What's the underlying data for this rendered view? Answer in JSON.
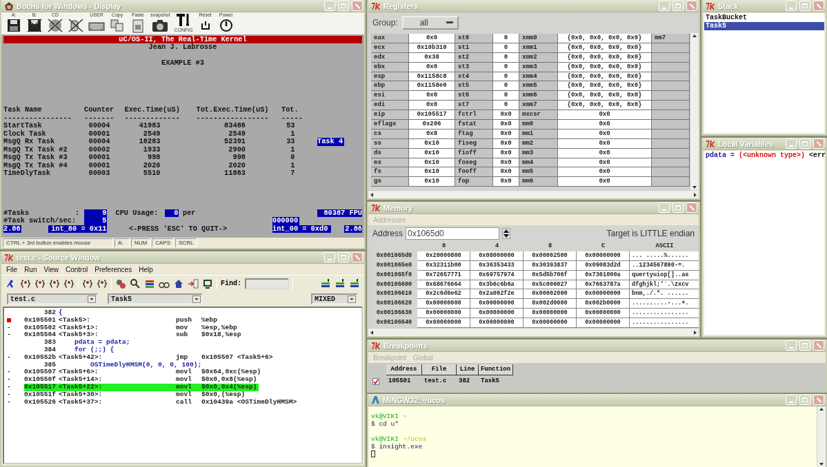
{
  "bochs": {
    "title": "Bochs for Windows - Display",
    "toolbar": [
      {
        "kind": "floppy",
        "label": "A:"
      },
      {
        "kind": "floppy-off",
        "label": "B:"
      },
      {
        "kind": "cdrom",
        "label": "CD"
      },
      {
        "kind": "mouse"
      },
      {
        "kind": "keyboard",
        "label": "USER"
      },
      {
        "kind": "copy",
        "label": "Copy"
      },
      {
        "kind": "paste",
        "label": "Paste"
      },
      {
        "kind": "camera",
        "label": "snapshot"
      },
      {
        "kind": "config",
        "label": "CONFIG"
      },
      {
        "kind": "reset",
        "label": "Reset"
      },
      {
        "kind": "power",
        "label": "Power"
      }
    ],
    "screen": {
      "banner": "uC/OS-II, The Real-Time Kernel",
      "author": "Jean J. Labrosse",
      "heading": "EXAMPLE #3",
      "columns": [
        {
          "label": "Task Name",
          "rule": "----------------"
        },
        {
          "label": "Counter",
          "rule": "-------"
        },
        {
          "label": "Exec.Time(uS)",
          "rule": "-------------"
        },
        {
          "label": "Tot.Exec.Time(uS)",
          "rule": "-----------------"
        },
        {
          "label": "Tot.",
          "rule": "-----"
        }
      ],
      "rows": [
        {
          "cells": [
            "StartTask",
            "00004",
            "41983",
            "83486",
            "53"
          ]
        },
        {
          "cells": [
            "Clock Task",
            "00001",
            "2549",
            "2549",
            "1"
          ]
        },
        {
          "cells": [
            "MsgQ Rx Task",
            "00004",
            "18283",
            "52391",
            "33"
          ],
          "badge": "Task 4"
        },
        {
          "cells": [
            "MsgQ Tx Task #2",
            "00002",
            "1933",
            "2900",
            "1"
          ]
        },
        {
          "cells": [
            "MsgQ Tx Task #3",
            "00001",
            "998",
            "998",
            "0"
          ]
        },
        {
          "cells": [
            "MsgQ Tx Task #4",
            "00001",
            "2020",
            "2020",
            "1"
          ]
        },
        {
          "cells": [
            "TimeDlyTask",
            "00003",
            "5510",
            "11863",
            "7"
          ]
        }
      ],
      "tasks_label": "#Tasks",
      "tasks_colon": ":",
      "tasks_value": "9",
      "cpu_label": "CPU Usage:",
      "cpu_value": "0",
      "cpu_unit": "per",
      "fpu": "80387 FPU",
      "switch_label": "#Task switch/sec:",
      "switch_value": "5",
      "hex_value": "000000",
      "left_version": "2.86",
      "int80": "int_80 = 0x11",
      "quit_hint": "<-PRESS 'ESC' TO QUIT->",
      "int00": "int_00 = 0xd0",
      "right_version": "2.86"
    },
    "status_bar": [
      "CTRL + 3rd button enables mouse",
      "A:",
      "NUM",
      "CAPS",
      "SCRL"
    ]
  },
  "source": {
    "title": "test.c - Source Window",
    "menu": [
      "File",
      "Run",
      "View",
      "Control",
      "Preferences",
      "Help"
    ],
    "find_label": "Find:",
    "file": "test.c",
    "function": "Task5",
    "mode": "MIXED",
    "lines": [
      {
        "kind": "src",
        "number": "382",
        "text": "{"
      },
      {
        "kind": "asm",
        "breakpoint": true,
        "current": false,
        "address": "0x105501",
        "symbol": "<Task5>:",
        "op": "push",
        "args": "%ebp"
      },
      {
        "kind": "asm",
        "marker": "-",
        "breakpoint": false,
        "current": false,
        "address": "0x105502",
        "symbol": "<Task5+1>:",
        "op": "mov",
        "args": "%esp,%ebp"
      },
      {
        "kind": "asm",
        "marker": "-",
        "breakpoint": false,
        "current": false,
        "address": "0x105504",
        "symbol": "<Task5+3>:",
        "op": "sub",
        "args": "$0x18,%esp"
      },
      {
        "kind": "src",
        "number": "383",
        "text": "    pdata = pdata;"
      },
      {
        "kind": "src",
        "number": "384",
        "text": "    for (;;) {"
      },
      {
        "kind": "asm",
        "marker": "-",
        "breakpoint": false,
        "current": false,
        "address": "0x10552b",
        "symbol": "<Task5+42>:",
        "op": "jmp",
        "args": "0x105507 <Task5+6>"
      },
      {
        "kind": "src",
        "number": "385",
        "text": "        OSTimeDlyHMSM(0, 0, 0, 100);"
      },
      {
        "kind": "asm",
        "marker": "-",
        "breakpoint": false,
        "current": false,
        "address": "0x105507",
        "symbol": "<Task5+6>:",
        "op": "movl",
        "args": "$0x64,0xc(%esp)"
      },
      {
        "kind": "asm",
        "marker": "-",
        "breakpoint": false,
        "current": false,
        "address": "0x10550f",
        "symbol": "<Task5+14>:",
        "op": "movl",
        "args": "$0x0,0x8(%esp)"
      },
      {
        "kind": "asm",
        "marker": "-",
        "breakpoint": false,
        "current": true,
        "address": "0x105517",
        "symbol": "<Task5+22>:",
        "op": "movl",
        "args": "$0x0,0x4(%esp)"
      },
      {
        "kind": "asm",
        "marker": "-",
        "breakpoint": false,
        "current": false,
        "address": "0x10551f",
        "symbol": "<Task5+30>:",
        "op": "movl",
        "args": "$0x0,(%esp)"
      },
      {
        "kind": "asm",
        "marker": "-",
        "breakpoint": false,
        "current": false,
        "address": "0x105526",
        "symbol": "<Task5+37>:",
        "op": "call",
        "args": "0x10439a <OSTimeDlyHMSM>"
      }
    ]
  },
  "registers": {
    "title": "Registers",
    "group_label": "Group:",
    "group": "all",
    "trailing_label": "mm7",
    "rows": [
      [
        "eax",
        "0x0",
        "st0",
        "0",
        "xmm0",
        "{0x0, 0x0, 0x0, 0x0}"
      ],
      [
        "ecx",
        "0x10b310",
        "st1",
        "0",
        "xmm1",
        "{0x0, 0x0, 0x0, 0x0}"
      ],
      [
        "edx",
        "0x38",
        "st2",
        "0",
        "xmm2",
        "{0x0, 0x0, 0x0, 0x0}"
      ],
      [
        "ebx",
        "0x0",
        "st3",
        "0",
        "xmm3",
        "{0x0, 0x0, 0x0, 0x0}"
      ],
      [
        "esp",
        "0x1158c8",
        "st4",
        "0",
        "xmm4",
        "{0x0, 0x0, 0x0, 0x0}"
      ],
      [
        "ebp",
        "0x1158e0",
        "st5",
        "0",
        "xmm5",
        "{0x0, 0x0, 0x0, 0x0}"
      ],
      [
        "esi",
        "0x0",
        "st6",
        "0",
        "xmm6",
        "{0x0, 0x0, 0x0, 0x0}"
      ],
      [
        "edi",
        "0x0",
        "st7",
        "0",
        "xmm7",
        "{0x0, 0x0, 0x0, 0x0}"
      ],
      [
        "eip",
        "0x105517",
        "fctrl",
        "0x0",
        "mxcsr",
        "0x0"
      ],
      [
        "eflags",
        "0x206",
        "fstat",
        "0x0",
        "mm0",
        "0x0"
      ],
      [
        "cs",
        "0x8",
        "ftag",
        "0x0",
        "mm1",
        "0x0"
      ],
      [
        "ss",
        "0x10",
        "fiseg",
        "0x0",
        "mm2",
        "0x0"
      ],
      [
        "ds",
        "0x10",
        "fioff",
        "0x0",
        "mm3",
        "0x0"
      ],
      [
        "es",
        "0x10",
        "foseg",
        "0x0",
        "mm4",
        "0x0"
      ],
      [
        "fs",
        "0x10",
        "fooff",
        "0x0",
        "mm5",
        "0x0"
      ],
      [
        "gs",
        "0x10",
        "fop",
        "0x0",
        "mm6",
        "0x0"
      ]
    ]
  },
  "memory": {
    "title": "Memory",
    "menu": [
      "Addresses"
    ],
    "address_label": "Address",
    "address": "0x1065d0",
    "endian": "Target is LITTLE endian",
    "columns": [
      "",
      "0",
      "4",
      "8",
      "C",
      "ASCII"
    ],
    "rows": [
      [
        "0x001065d0",
        "0x20000800",
        "0x08000000",
        "0x00002500",
        "0x00000000",
        "... .....%......"
      ],
      [
        "0x001065e0",
        "0x32311b00",
        "0x36353433",
        "0x30393837",
        "0x09083d2d",
        "..1234567890-=."
      ],
      [
        "0x001065f0",
        "0x72657771",
        "0x69757974",
        "0x5d5b706f",
        "0x7361000a",
        "quertyuiop[]..as"
      ],
      [
        "0x00106600",
        "0x68676664",
        "0x3b6c6b6a",
        "0x5c006027",
        "0x7663787a",
        "dfghjkl;'`.\\zxcv"
      ],
      [
        "0x00106610",
        "0x2c6d6e62",
        "0x2a002f2e",
        "0x00002000",
        "0x00000000",
        "bnm,./.*. ......"
      ],
      [
        "0x00106620",
        "0x00000000",
        "0x00000000",
        "0x002d0000",
        "0x002b0000",
        "..........-...+."
      ],
      [
        "0x00106630",
        "0x00000000",
        "0x00000000",
        "0x00000000",
        "0x00000000",
        "................"
      ],
      [
        "0x00106640",
        "0x00000000",
        "0x00000000",
        "0x00000000",
        "0x00000000",
        "................"
      ]
    ]
  },
  "breakpoints": {
    "title": "Breakpoints",
    "menu": [
      "Breakpoint",
      "Global"
    ],
    "columns": [
      "Address",
      "File",
      "Line",
      "Function"
    ],
    "rows": [
      {
        "checked": true,
        "cells": [
          "105501",
          "test.c",
          "382",
          "Task5"
        ]
      }
    ]
  },
  "terminal": {
    "title": "MINGW32:~/ucos",
    "lines": [
      {
        "kind": "prompt",
        "user": "vk@VIKI",
        "path": "~"
      },
      {
        "kind": "command",
        "text": "$ cd u*"
      },
      {
        "kind": "blank"
      },
      {
        "kind": "prompt",
        "user": "vk@VIKI",
        "path": "~/ucos"
      },
      {
        "kind": "command",
        "text": "$ insight.exe"
      },
      {
        "kind": "cursor"
      }
    ]
  },
  "stack": {
    "title": "Stack",
    "items": [
      {
        "label": "TaskBucket",
        "selected": false
      },
      {
        "label": "Task5",
        "selected": true
      }
    ]
  },
  "locals": {
    "title": "Local Variables",
    "variables": [
      {
        "name": "pdata",
        "equals": "=",
        "value": "(<unknown type>)",
        "error": "<err"
      }
    ]
  }
}
